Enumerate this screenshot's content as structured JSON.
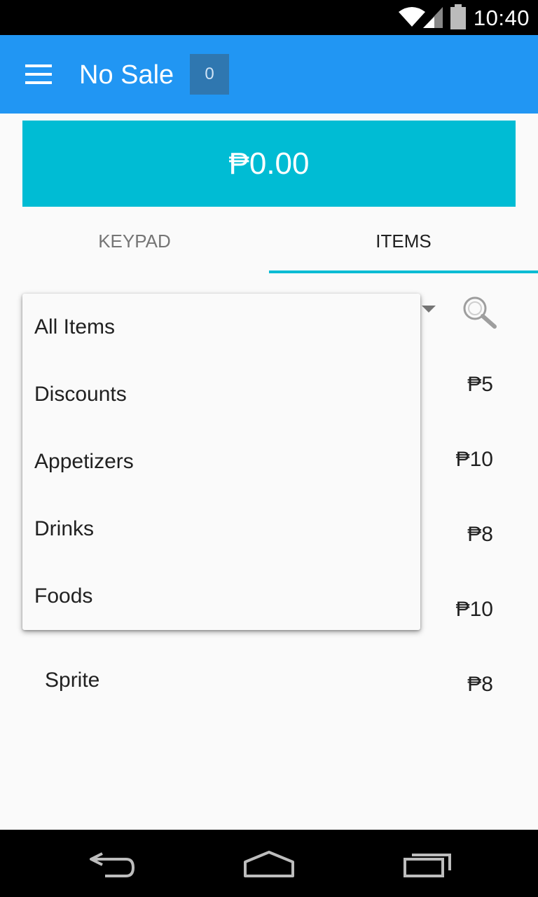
{
  "status_bar": {
    "time": "10:40",
    "icons": [
      "wifi-icon",
      "signal-icon",
      "battery-icon"
    ]
  },
  "app_bar": {
    "title": "No Sale",
    "count": "0",
    "menu_icon": "hamburger-menu-icon",
    "color": "#2196f3"
  },
  "total": {
    "amount": "₱0.00",
    "color": "#00bcd4"
  },
  "tabs": [
    {
      "label": "KEYPAD",
      "selected": false
    },
    {
      "label": "ITEMS",
      "selected": true
    }
  ],
  "category_dropdown": {
    "open": true,
    "options": [
      "All Items",
      "Discounts",
      "Appetizers",
      "Drinks",
      "Foods"
    ]
  },
  "search_icon": "search-icon",
  "items": [
    {
      "name": "",
      "price": "₱5"
    },
    {
      "name": "",
      "price": "₱10"
    },
    {
      "name": "",
      "price": "₱8"
    },
    {
      "name": "",
      "price": "₱10"
    },
    {
      "name": "Sprite",
      "price": "₱8"
    }
  ],
  "nav_bar": {
    "icons": [
      "back-icon",
      "home-icon",
      "recent-apps-icon"
    ]
  }
}
